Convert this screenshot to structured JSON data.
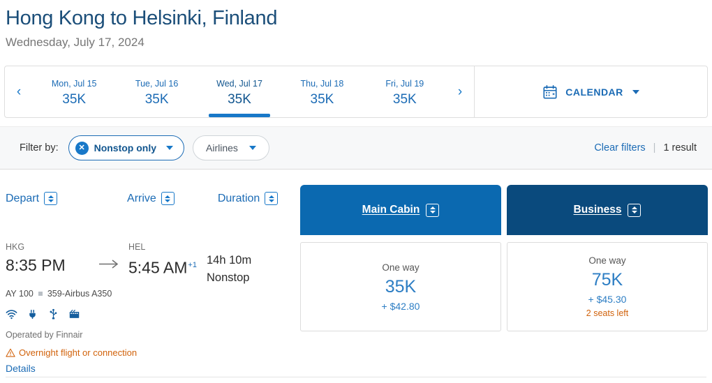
{
  "header": {
    "route_title": "Hong Kong to Helsinki, Finland",
    "date_subtitle": "Wednesday, July 17, 2024"
  },
  "date_strip": {
    "prev_arrow": "‹",
    "next_arrow": "›",
    "tabs": [
      {
        "day": "Mon, Jul 15",
        "price": "35K",
        "selected": false
      },
      {
        "day": "Tue, Jul 16",
        "price": "35K",
        "selected": false
      },
      {
        "day": "Wed, Jul 17",
        "price": "35K",
        "selected": true
      },
      {
        "day": "Thu, Jul 18",
        "price": "35K",
        "selected": false
      },
      {
        "day": "Fri, Jul 19",
        "price": "35K",
        "selected": false
      }
    ],
    "calendar_label": "CALENDAR",
    "calendar_icon": "calendar-icon"
  },
  "filters": {
    "label": "Filter by:",
    "chips": [
      {
        "label": "Nonstop only",
        "active": true,
        "remove_icon": "close-x-icon"
      },
      {
        "label": "Airlines",
        "active": false
      }
    ],
    "clear_label": "Clear filters",
    "separator": "|",
    "result_count": "1 result"
  },
  "columns": {
    "depart": "Depart",
    "arrive": "Arrive",
    "duration": "Duration",
    "sort_icon": "sort-updown-icon"
  },
  "cabins": [
    {
      "name": "Main Cabin",
      "color": "#0b69b0"
    },
    {
      "name": "Business",
      "color": "#0a4a7d"
    }
  ],
  "flight": {
    "depart_code": "HKG",
    "depart_time": "8:35 PM",
    "arrow_icon": "arrow-right-icon",
    "arrive_code": "HEL",
    "arrive_time": "5:45 AM",
    "arrive_day_offset": "+1",
    "duration": "14h 10m",
    "stops": "Nonstop",
    "flight_number": "AY 100",
    "aircraft": "359-Airbus A350",
    "amenities": [
      "wifi-icon",
      "power-outlet-icon",
      "usb-port-icon",
      "entertainment-icon"
    ],
    "operated_by": "Operated by Finnair",
    "warning_icon": "warning-triangle-icon",
    "warning_text": "Overnight flight or connection",
    "details_label": "Details"
  },
  "prices": [
    {
      "cabin": "Main Cabin",
      "trip_type": "One way",
      "miles": "35K",
      "taxes": "+ $42.80",
      "seats_left": ""
    },
    {
      "cabin": "Business",
      "trip_type": "One way",
      "miles": "75K",
      "taxes": "+ $45.30",
      "seats_left": "2 seats left"
    }
  ],
  "colors": {
    "title_navy": "#1b4e79",
    "link_blue": "#1b6bb5",
    "accent_blue": "#1878c8",
    "main_cabin": "#0b69b0",
    "business": "#0a4a7d",
    "warning_orange": "#d1620b"
  }
}
